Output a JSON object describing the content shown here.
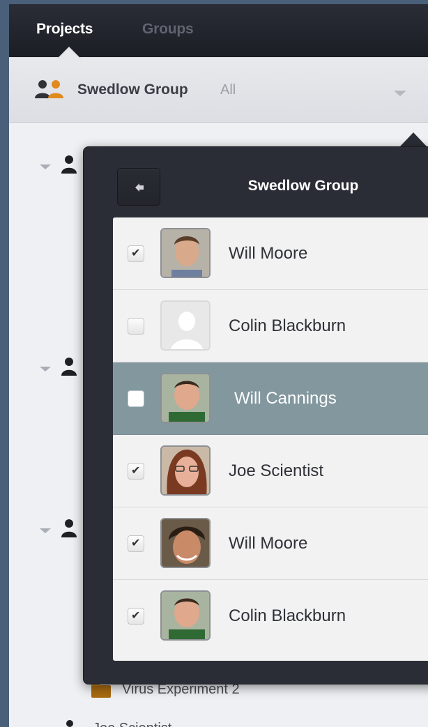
{
  "topbar": {
    "tabs": [
      {
        "label": "Projects",
        "active": true
      },
      {
        "label": "Groups",
        "active": false
      }
    ]
  },
  "group_selector": {
    "group_name": "Swedlow Group",
    "filter": "All",
    "icon": "group-people-icon"
  },
  "tree": {
    "folder_label": "Virus Experiment 2",
    "bottom_user": "Joe Scientist"
  },
  "popover": {
    "title": "Swedlow Group",
    "back_icon": "back-arrow-icon",
    "members": [
      {
        "name": "Will Moore",
        "checked": true,
        "selected": false,
        "avatar": "photo"
      },
      {
        "name": "Colin Blackburn",
        "checked": false,
        "selected": false,
        "avatar": "placeholder"
      },
      {
        "name": "Will Cannings",
        "checked": false,
        "selected": true,
        "avatar": "photo"
      },
      {
        "name": "Joe Scientist",
        "checked": true,
        "selected": false,
        "avatar": "photo"
      },
      {
        "name": "Will Moore",
        "checked": true,
        "selected": false,
        "avatar": "photo"
      },
      {
        "name": "Colin Blackburn",
        "checked": true,
        "selected": false,
        "avatar": "photo"
      }
    ]
  },
  "colors": {
    "window_bg": "#4a5f7a",
    "topbar": "#22242c",
    "popover": "#2b2d36",
    "selected_row": "#83979f",
    "group_icon_orange": "#e08a1e"
  }
}
